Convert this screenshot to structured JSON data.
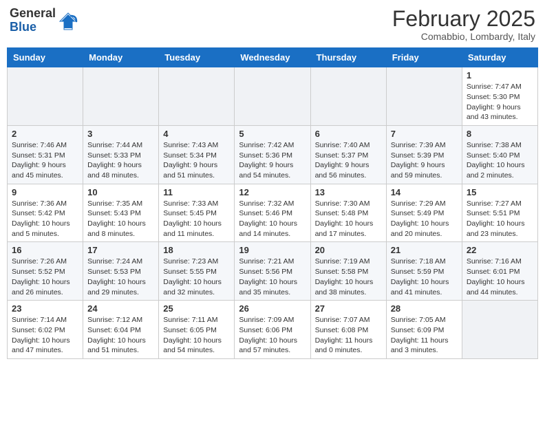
{
  "logo": {
    "general": "General",
    "blue": "Blue"
  },
  "title": "February 2025",
  "location": "Comabbio, Lombardy, Italy",
  "days_of_week": [
    "Sunday",
    "Monday",
    "Tuesday",
    "Wednesday",
    "Thursday",
    "Friday",
    "Saturday"
  ],
  "weeks": [
    [
      {
        "day": "",
        "info": ""
      },
      {
        "day": "",
        "info": ""
      },
      {
        "day": "",
        "info": ""
      },
      {
        "day": "",
        "info": ""
      },
      {
        "day": "",
        "info": ""
      },
      {
        "day": "",
        "info": ""
      },
      {
        "day": "1",
        "info": "Sunrise: 7:47 AM\nSunset: 5:30 PM\nDaylight: 9 hours and 43 minutes."
      }
    ],
    [
      {
        "day": "2",
        "info": "Sunrise: 7:46 AM\nSunset: 5:31 PM\nDaylight: 9 hours and 45 minutes."
      },
      {
        "day": "3",
        "info": "Sunrise: 7:44 AM\nSunset: 5:33 PM\nDaylight: 9 hours and 48 minutes."
      },
      {
        "day": "4",
        "info": "Sunrise: 7:43 AM\nSunset: 5:34 PM\nDaylight: 9 hours and 51 minutes."
      },
      {
        "day": "5",
        "info": "Sunrise: 7:42 AM\nSunset: 5:36 PM\nDaylight: 9 hours and 54 minutes."
      },
      {
        "day": "6",
        "info": "Sunrise: 7:40 AM\nSunset: 5:37 PM\nDaylight: 9 hours and 56 minutes."
      },
      {
        "day": "7",
        "info": "Sunrise: 7:39 AM\nSunset: 5:39 PM\nDaylight: 9 hours and 59 minutes."
      },
      {
        "day": "8",
        "info": "Sunrise: 7:38 AM\nSunset: 5:40 PM\nDaylight: 10 hours and 2 minutes."
      }
    ],
    [
      {
        "day": "9",
        "info": "Sunrise: 7:36 AM\nSunset: 5:42 PM\nDaylight: 10 hours and 5 minutes."
      },
      {
        "day": "10",
        "info": "Sunrise: 7:35 AM\nSunset: 5:43 PM\nDaylight: 10 hours and 8 minutes."
      },
      {
        "day": "11",
        "info": "Sunrise: 7:33 AM\nSunset: 5:45 PM\nDaylight: 10 hours and 11 minutes."
      },
      {
        "day": "12",
        "info": "Sunrise: 7:32 AM\nSunset: 5:46 PM\nDaylight: 10 hours and 14 minutes."
      },
      {
        "day": "13",
        "info": "Sunrise: 7:30 AM\nSunset: 5:48 PM\nDaylight: 10 hours and 17 minutes."
      },
      {
        "day": "14",
        "info": "Sunrise: 7:29 AM\nSunset: 5:49 PM\nDaylight: 10 hours and 20 minutes."
      },
      {
        "day": "15",
        "info": "Sunrise: 7:27 AM\nSunset: 5:51 PM\nDaylight: 10 hours and 23 minutes."
      }
    ],
    [
      {
        "day": "16",
        "info": "Sunrise: 7:26 AM\nSunset: 5:52 PM\nDaylight: 10 hours and 26 minutes."
      },
      {
        "day": "17",
        "info": "Sunrise: 7:24 AM\nSunset: 5:53 PM\nDaylight: 10 hours and 29 minutes."
      },
      {
        "day": "18",
        "info": "Sunrise: 7:23 AM\nSunset: 5:55 PM\nDaylight: 10 hours and 32 minutes."
      },
      {
        "day": "19",
        "info": "Sunrise: 7:21 AM\nSunset: 5:56 PM\nDaylight: 10 hours and 35 minutes."
      },
      {
        "day": "20",
        "info": "Sunrise: 7:19 AM\nSunset: 5:58 PM\nDaylight: 10 hours and 38 minutes."
      },
      {
        "day": "21",
        "info": "Sunrise: 7:18 AM\nSunset: 5:59 PM\nDaylight: 10 hours and 41 minutes."
      },
      {
        "day": "22",
        "info": "Sunrise: 7:16 AM\nSunset: 6:01 PM\nDaylight: 10 hours and 44 minutes."
      }
    ],
    [
      {
        "day": "23",
        "info": "Sunrise: 7:14 AM\nSunset: 6:02 PM\nDaylight: 10 hours and 47 minutes."
      },
      {
        "day": "24",
        "info": "Sunrise: 7:12 AM\nSunset: 6:04 PM\nDaylight: 10 hours and 51 minutes."
      },
      {
        "day": "25",
        "info": "Sunrise: 7:11 AM\nSunset: 6:05 PM\nDaylight: 10 hours and 54 minutes."
      },
      {
        "day": "26",
        "info": "Sunrise: 7:09 AM\nSunset: 6:06 PM\nDaylight: 10 hours and 57 minutes."
      },
      {
        "day": "27",
        "info": "Sunrise: 7:07 AM\nSunset: 6:08 PM\nDaylight: 11 hours and 0 minutes."
      },
      {
        "day": "28",
        "info": "Sunrise: 7:05 AM\nSunset: 6:09 PM\nDaylight: 11 hours and 3 minutes."
      },
      {
        "day": "",
        "info": ""
      }
    ]
  ]
}
